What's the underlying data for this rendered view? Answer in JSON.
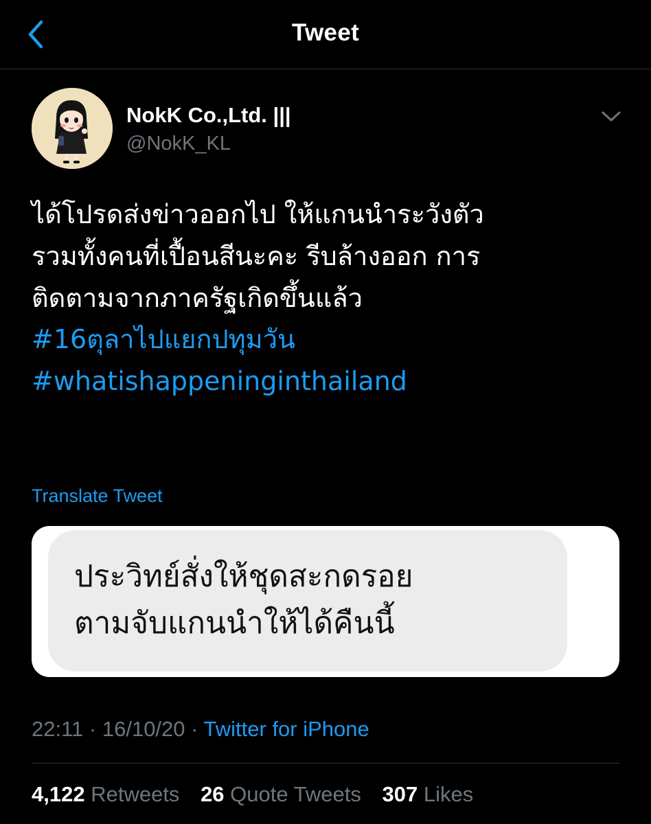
{
  "header": {
    "title": "Tweet",
    "back_icon": "chevron-left-icon"
  },
  "author": {
    "display_name": "NokK Co.,Ltd. |||",
    "handle": "@NokK_KL",
    "avatar_icon": "cartoon-girl-avatar"
  },
  "tweet": {
    "text_lines": [
      "ได้โปรดส่งข่าวออกไป  ให้แกนนำระวังตัว",
      "รวมทั้งคนที่เปื้อนสีนะคะ รีบล้างออก การ",
      "ติดตามจากภาครัฐเกิดขึ้นแล้ว"
    ],
    "hashtags": [
      "#16ตุลาไปแยกปทุมวัน",
      "#whatishappeninginthailand"
    ],
    "translate_label": "Translate Tweet",
    "media_text_lines": [
      "ประวิทย์สั่งให้ชุดสะกดรอย",
      "ตามจับแกนนำให้ได้คืนนี้"
    ],
    "time": "22:11",
    "date": "16/10/20",
    "separator": "·",
    "source": "Twitter for iPhone"
  },
  "stats": {
    "retweets_count": "4,122",
    "retweets_label": "Retweets",
    "quote_count": "26",
    "quote_label": "Quote Tweets",
    "likes_count": "307",
    "likes_label": "Likes"
  },
  "colors": {
    "background": "#000000",
    "accent": "#1d9bf0",
    "secondary_text": "#6e767d",
    "divider": "#2f3336"
  }
}
